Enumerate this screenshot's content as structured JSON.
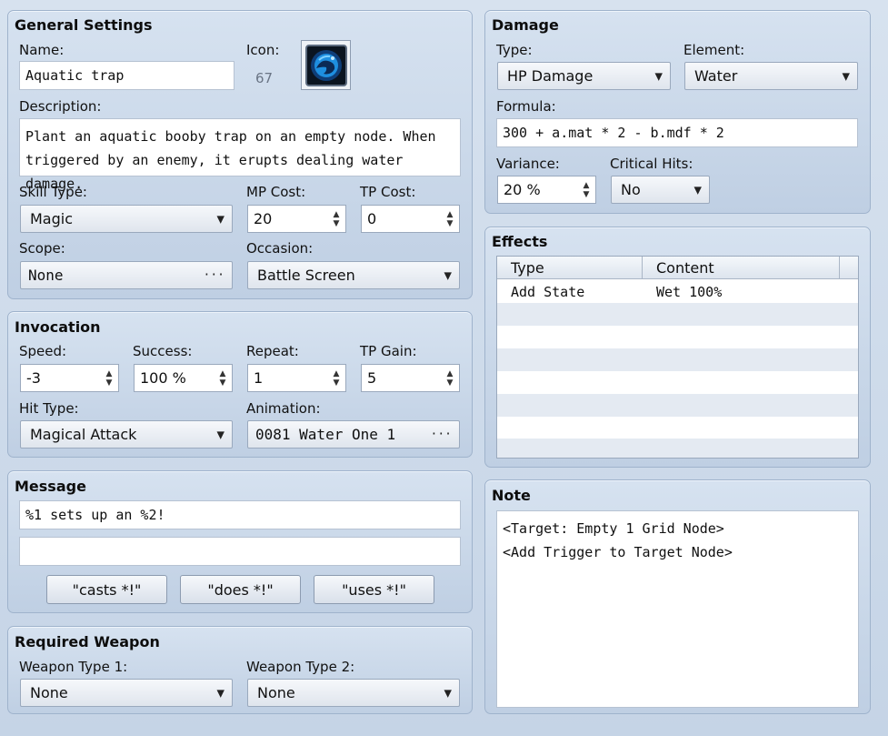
{
  "general": {
    "title": "General Settings",
    "name_label": "Name:",
    "name_value": "Aquatic trap",
    "icon_label": "Icon:",
    "icon_index": "67",
    "description_label": "Description:",
    "description_lines": [
      "Plant an aquatic booby trap on an empty node. When",
      "triggered by an enemy, it erupts dealing water damage."
    ],
    "skill_type_label": "Skill Type:",
    "skill_type_value": "Magic",
    "mp_cost_label": "MP Cost:",
    "mp_cost_value": "20",
    "tp_cost_label": "TP Cost:",
    "tp_cost_value": "0",
    "scope_label": "Scope:",
    "scope_value": "None",
    "occasion_label": "Occasion:",
    "occasion_value": "Battle Screen"
  },
  "invocation": {
    "title": "Invocation",
    "speed_label": "Speed:",
    "speed_value": "-3",
    "success_label": "Success:",
    "success_value": "100 %",
    "repeat_label": "Repeat:",
    "repeat_value": "1",
    "tp_gain_label": "TP Gain:",
    "tp_gain_value": "5",
    "hit_type_label": "Hit Type:",
    "hit_type_value": "Magical Attack",
    "animation_label": "Animation:",
    "animation_value": "0081 Water One 1"
  },
  "message": {
    "title": "Message",
    "line1": "%1 sets up an %2!",
    "line2": "",
    "buttons": [
      "\"casts *!\"",
      "\"does *!\"",
      "\"uses *!\""
    ]
  },
  "weapon": {
    "title": "Required Weapon",
    "type1_label": "Weapon Type 1:",
    "type1_value": "None",
    "type2_label": "Weapon Type 2:",
    "type2_value": "None"
  },
  "damage": {
    "title": "Damage",
    "type_label": "Type:",
    "type_value": "HP Damage",
    "element_label": "Element:",
    "element_value": "Water",
    "formula_label": "Formula:",
    "formula_value": "300 + a.mat * 2 - b.mdf * 2",
    "variance_label": "Variance:",
    "variance_value": "20 %",
    "critical_label": "Critical Hits:",
    "critical_value": "No"
  },
  "effects": {
    "title": "Effects",
    "columns": [
      "Type",
      "Content"
    ],
    "rows": [
      {
        "type": "Add State",
        "content": "Wet 100%"
      }
    ]
  },
  "note": {
    "title": "Note",
    "lines": [
      "<Target: Empty 1 Grid Node>",
      "<Add Trigger to Target Node>"
    ]
  },
  "glyphs": {
    "dropdown": "▼",
    "ellipsis": "···",
    "spin_up": "▲",
    "spin_down": "▼"
  },
  "colors": {
    "icon_blue": "#1e8fe0"
  }
}
